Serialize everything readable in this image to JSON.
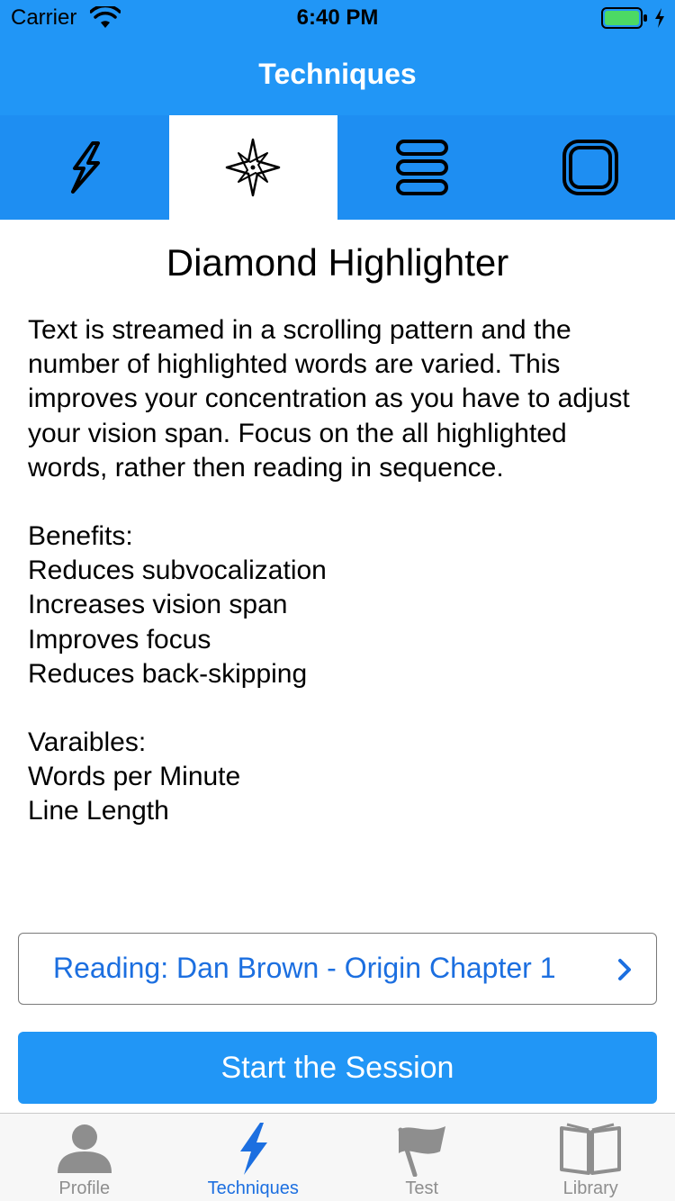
{
  "status_bar": {
    "carrier": "Carrier",
    "time": "6:40 PM"
  },
  "nav": {
    "title": "Techniques"
  },
  "technique_tabs": [
    {
      "icon": "lightning-icon",
      "active": false
    },
    {
      "icon": "compass-star-icon",
      "active": true
    },
    {
      "icon": "stacked-lines-icon",
      "active": false
    },
    {
      "icon": "rounded-square-icon",
      "active": false
    }
  ],
  "technique": {
    "title": "Diamond Highlighter",
    "description": "Text is streamed in a scrolling pattern and the number of highlighted words are varied. This improves your concentration as you have to adjust your vision span. Focus on the all highlighted words, rather then reading in sequence.",
    "benefits_heading": "Benefits:",
    "benefits": [
      "Reduces subvocalization",
      "Increases vision span",
      "Improves focus",
      "Reduces back-skipping"
    ],
    "variables_heading": "Varaibles:",
    "variables": [
      "Words per Minute",
      "Line Length"
    ]
  },
  "reading": {
    "label": "Reading: Dan Brown - Origin Chapter 1"
  },
  "start_button": {
    "label": "Start the Session"
  },
  "tab_bar": {
    "items": [
      {
        "label": "Profile",
        "icon": "person-icon",
        "active": false
      },
      {
        "label": "Techniques",
        "icon": "lightning-icon",
        "active": true
      },
      {
        "label": "Test",
        "icon": "flag-icon",
        "active": false
      },
      {
        "label": "Library",
        "icon": "book-icon",
        "active": false
      }
    ]
  },
  "colors": {
    "header_blue": "#2196f6",
    "tab_blue": "#1e8ef2",
    "link_blue": "#1c6fe0",
    "battery_green": "#4cd964",
    "tab_inactive_gray": "#8e8e8e"
  }
}
